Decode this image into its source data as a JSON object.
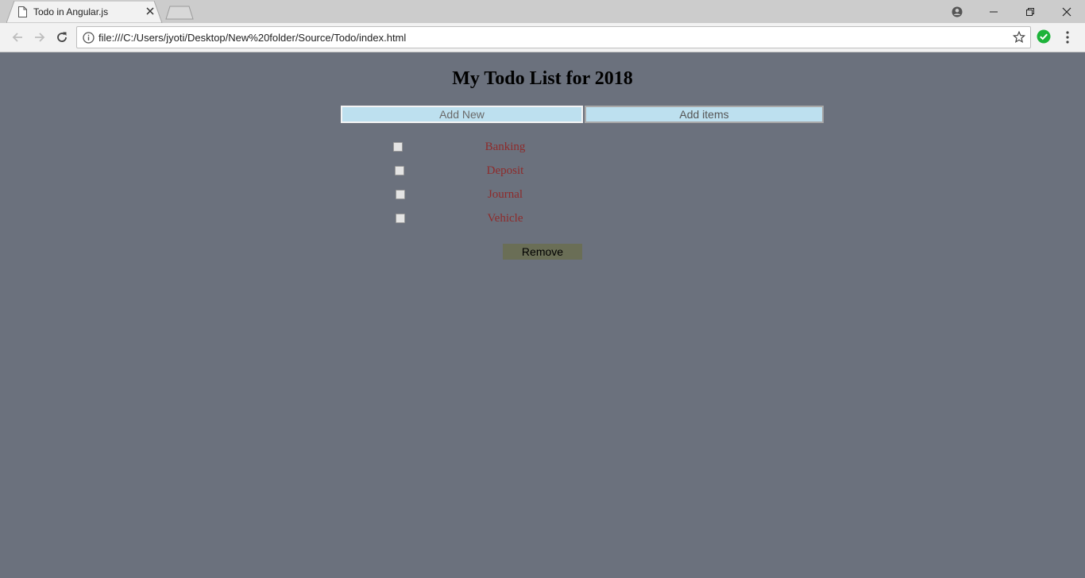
{
  "browser": {
    "tab_title": "Todo in Angular.js",
    "url": "file:///C:/Users/jyoti/Desktop/New%20folder/Source/Todo/index.html"
  },
  "page": {
    "title": "My Todo List for 2018",
    "new_item_placeholder": "Add New",
    "add_button_label": "Add items",
    "todos": [
      {
        "label": "Banking",
        "checked": false
      },
      {
        "label": "Deposit",
        "checked": false
      },
      {
        "label": "Journal",
        "checked": false
      },
      {
        "label": "Vehicle",
        "checked": false
      }
    ],
    "remove_button_label": "Remove"
  },
  "colors": {
    "page_background": "#6b717d",
    "input_background": "#bde0ef",
    "todo_text": "#8e2b2b",
    "remove_button": "#6a6e56"
  }
}
